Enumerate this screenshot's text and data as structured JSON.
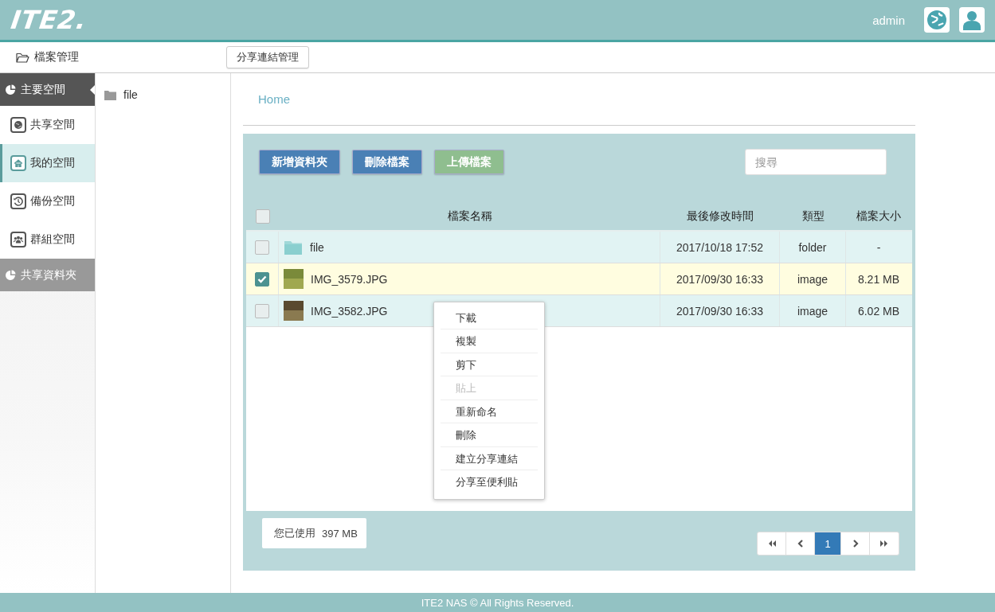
{
  "header": {
    "logo": "ITE2.",
    "user": "admin"
  },
  "nav": {
    "title": "檔案管理",
    "share_button": "分享連結管理"
  },
  "sidebar": {
    "items": [
      {
        "label": "主要空間",
        "kind": "section",
        "selected": true
      },
      {
        "label": "共享空間",
        "kind": "item",
        "selected": false
      },
      {
        "label": "我的空間",
        "kind": "item",
        "selected": true
      },
      {
        "label": "備份空間",
        "kind": "item",
        "selected": false
      },
      {
        "label": "群組空間",
        "kind": "item",
        "selected": false
      },
      {
        "label": "共享資料夾",
        "kind": "section",
        "selected": false
      }
    ]
  },
  "tree": {
    "items": [
      {
        "label": "file"
      }
    ]
  },
  "breadcrumb": "Home",
  "toolbar": {
    "buttons": [
      {
        "label": "新增資料夾",
        "kind": "primary"
      },
      {
        "label": "刪除檔案",
        "kind": "primary"
      },
      {
        "label": "上傳檔案",
        "kind": "success"
      }
    ],
    "search": {
      "placeholder": "搜尋"
    }
  },
  "table": {
    "select_all": {
      "checked": false
    },
    "columns": [
      "檔案名稱",
      "最後修改時間",
      "類型",
      "檔案大小"
    ],
    "rows": [
      {
        "name": "file",
        "kind": "folder",
        "modified": "2017/10/18 17:52",
        "type": "folder",
        "size": "-",
        "checked": false
      },
      {
        "name": "IMG_3579.JPG",
        "kind": "image",
        "modified": "2017/09/30 16:33",
        "type": "image",
        "size": "8.21 MB",
        "checked": true
      },
      {
        "name": "IMG_3582.JPG",
        "kind": "image",
        "modified": "2017/09/30 16:33",
        "type": "image",
        "size": "6.02 MB",
        "checked": false
      }
    ]
  },
  "context_menu": {
    "items": [
      {
        "label": "下載",
        "disabled": false
      },
      {
        "label": "複製",
        "disabled": false
      },
      {
        "label": "剪下",
        "disabled": false
      },
      {
        "label": "貼上",
        "disabled": true
      },
      {
        "label": "重新命名",
        "disabled": false
      },
      {
        "label": "刪除",
        "disabled": false
      },
      {
        "label": "建立分享連結",
        "disabled": false
      },
      {
        "label": "分享至便利貼",
        "disabled": false
      }
    ]
  },
  "usage": {
    "label": "您已使用",
    "value": "397 MB"
  },
  "pagination": {
    "pages": [
      {
        "label": "1",
        "selected": true
      }
    ]
  },
  "footer": "ITE2 NAS © All Rights Reserved."
}
